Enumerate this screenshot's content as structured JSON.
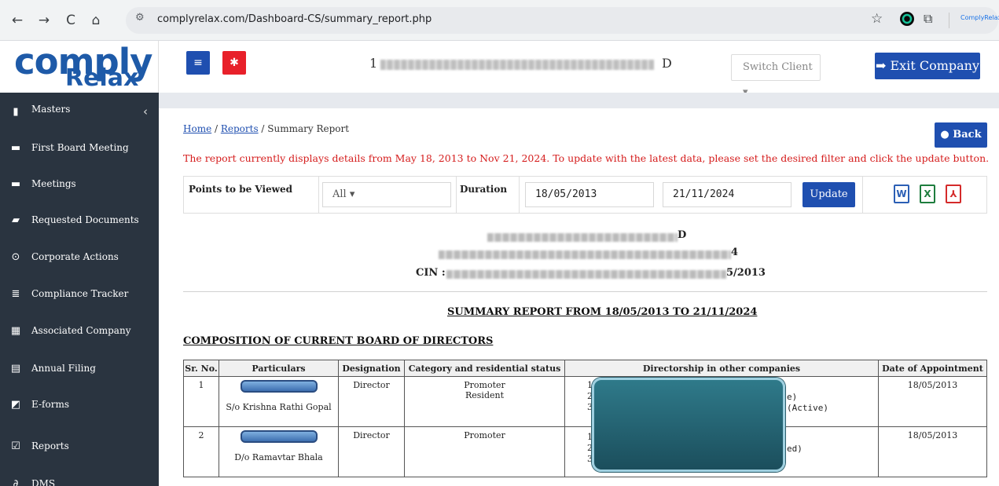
{
  "browser": {
    "url": "complyrelax.com/Dashboard-CS/summary_report.php",
    "back_icon": "←",
    "forward_icon": "→",
    "reload_icon": "C",
    "home_icon": "⌂",
    "site_icon": "⚙",
    "star_icon": "☆",
    "extensions_icon": "⧉",
    "profile_label": "ComplyRelax"
  },
  "logo": {
    "top": "comply",
    "bottom": "Relax"
  },
  "header": {
    "menu_icon": "≡",
    "settings_icon": "✱",
    "company_prefix": "1",
    "company_suffix": "D",
    "switch_client": "Switch Client ▾",
    "exit_label": "➡ Exit Company"
  },
  "sidebar": {
    "items": [
      {
        "icon": "▮",
        "label": "Masters"
      },
      {
        "icon": "▬",
        "label": "First Board Meeting"
      },
      {
        "icon": "▬",
        "label": "Meetings"
      },
      {
        "icon": "▰",
        "label": "Requested Documents"
      },
      {
        "icon": "⊙",
        "label": "Corporate Actions"
      },
      {
        "icon": "≣",
        "label": "Compliance Tracker"
      },
      {
        "icon": "▦",
        "label": "Associated Company"
      },
      {
        "icon": "▤",
        "label": "Annual Filing"
      },
      {
        "icon": "◩",
        "label": "E-forms"
      },
      {
        "icon": "☑",
        "label": "Reports"
      },
      {
        "icon": "∂",
        "label": "DMS"
      }
    ],
    "chevron": "‹"
  },
  "breadcrumb": {
    "home": "Home",
    "sep1": " / ",
    "reports": "Reports",
    "sep2": " / ",
    "current": "Summary Report"
  },
  "back_label": "● Back",
  "notice": "The report currently displays details from May 18, 2013 to Nov 21, 2024. To update with the latest data, please set the desired filter and click the update button.",
  "filter": {
    "points_label": "Points to be Viewed",
    "points_value": "All ▾",
    "duration_label": "Duration",
    "from_date": "18/05/2013",
    "to_date": "21/11/2024",
    "update_label": "Update",
    "word_icon": "W",
    "excel_icon": "X",
    "pdf_icon": "⅄"
  },
  "company_block": {
    "name_tail": "D",
    "address_tail": "4",
    "cin_label": "CIN :",
    "cin_tail": "5/2013"
  },
  "report_title": "SUMMARY REPORT FROM 18/05/2013 TO 21/11/2024",
  "section_title": "COMPOSITION OF CURRENT BOARD OF DIRECTORS",
  "table": {
    "headers": [
      "Sr. No.",
      "Particulars",
      "Designation",
      "Category and residential status",
      "Directorship in other companies",
      "Date of Appointment"
    ],
    "rows": [
      {
        "sr": "1",
        "parent": "S/o Krishna Rathi Gopal",
        "designation": "Director",
        "category": "Promoter",
        "residence": "Resident",
        "date": "18/05/2013",
        "dir_nums": [
          "1",
          "2",
          "3"
        ],
        "dir_tails": [
          "",
          "e)",
          "(Active)"
        ]
      },
      {
        "sr": "2",
        "parent": "D/o Ramavtar Bhala",
        "designation": "Director",
        "category": "Promoter",
        "residence": "",
        "date": "18/05/2013",
        "dir_nums": [
          "1",
          "2",
          "3."
        ],
        "dir_tails": [
          "",
          "ed)",
          ""
        ]
      }
    ]
  },
  "colors": {
    "brand": "#1f4fb0",
    "danger": "#e8202a",
    "sidebar": "#2a3440",
    "notice": "#d51c1c"
  }
}
